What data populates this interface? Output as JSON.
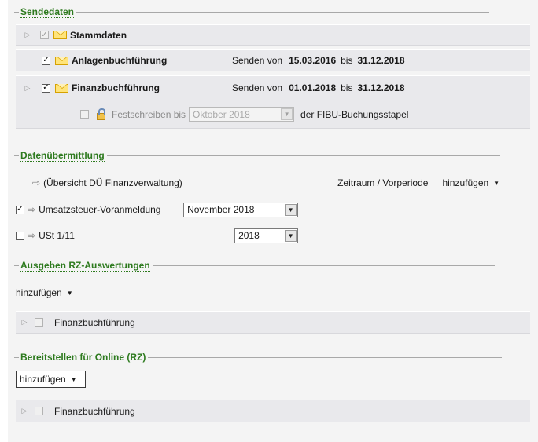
{
  "sections": {
    "sendedaten": "Sendedaten",
    "datenuebermittlung": "Datenübermittlung",
    "ausgeben": "Ausgeben RZ-Auswertungen",
    "bereitstellen": "Bereitstellen für Online (RZ)"
  },
  "sendedaten": {
    "stammdaten": {
      "label": "Stammdaten",
      "checked": true,
      "enabled": false
    },
    "anlagen": {
      "label": "Anlagenbuchführung",
      "checked": true,
      "senden_von": "Senden von",
      "from": "15.03.2016",
      "bis": "bis",
      "to": "31.12.2018"
    },
    "fibu": {
      "label": "Finanzbuchführung",
      "checked": true,
      "senden_von": "Senden von",
      "from": "01.01.2018",
      "bis": "bis",
      "to": "31.12.2018"
    },
    "festschreiben": {
      "label": "Festschreiben bis",
      "month": "Oktober 2018",
      "suffix": "der FIBU-Buchungsstapel",
      "checked": false,
      "enabled": false
    }
  },
  "datenuebermittlung": {
    "overview": "(Übersicht DÜ Finanzverwaltung)",
    "zeitraum": "Zeitraum / Vorperiode",
    "add": "hinzufügen",
    "items": [
      {
        "label": "Umsatzsteuer-Voranmeldung",
        "checked": true,
        "period": "November 2018"
      },
      {
        "label": "USt 1/11",
        "checked": false,
        "period": "2018"
      }
    ]
  },
  "ausgeben": {
    "add": "hinzufügen",
    "item": "Finanzbuchführung"
  },
  "bereitstellen": {
    "add": "hinzufügen",
    "item": "Finanzbuchführung"
  },
  "icons": {
    "expander": "triangle-right-icon",
    "arrow": "arrow-right-icon",
    "envelope": "envelope-icon",
    "lock": "lock-icon",
    "caret": "caret-down-icon"
  },
  "colors": {
    "section_title": "#2d7a1e",
    "panel": "#f4f4f4",
    "row_shade": "#e9e9ec",
    "envelope": "#ffe47a"
  }
}
